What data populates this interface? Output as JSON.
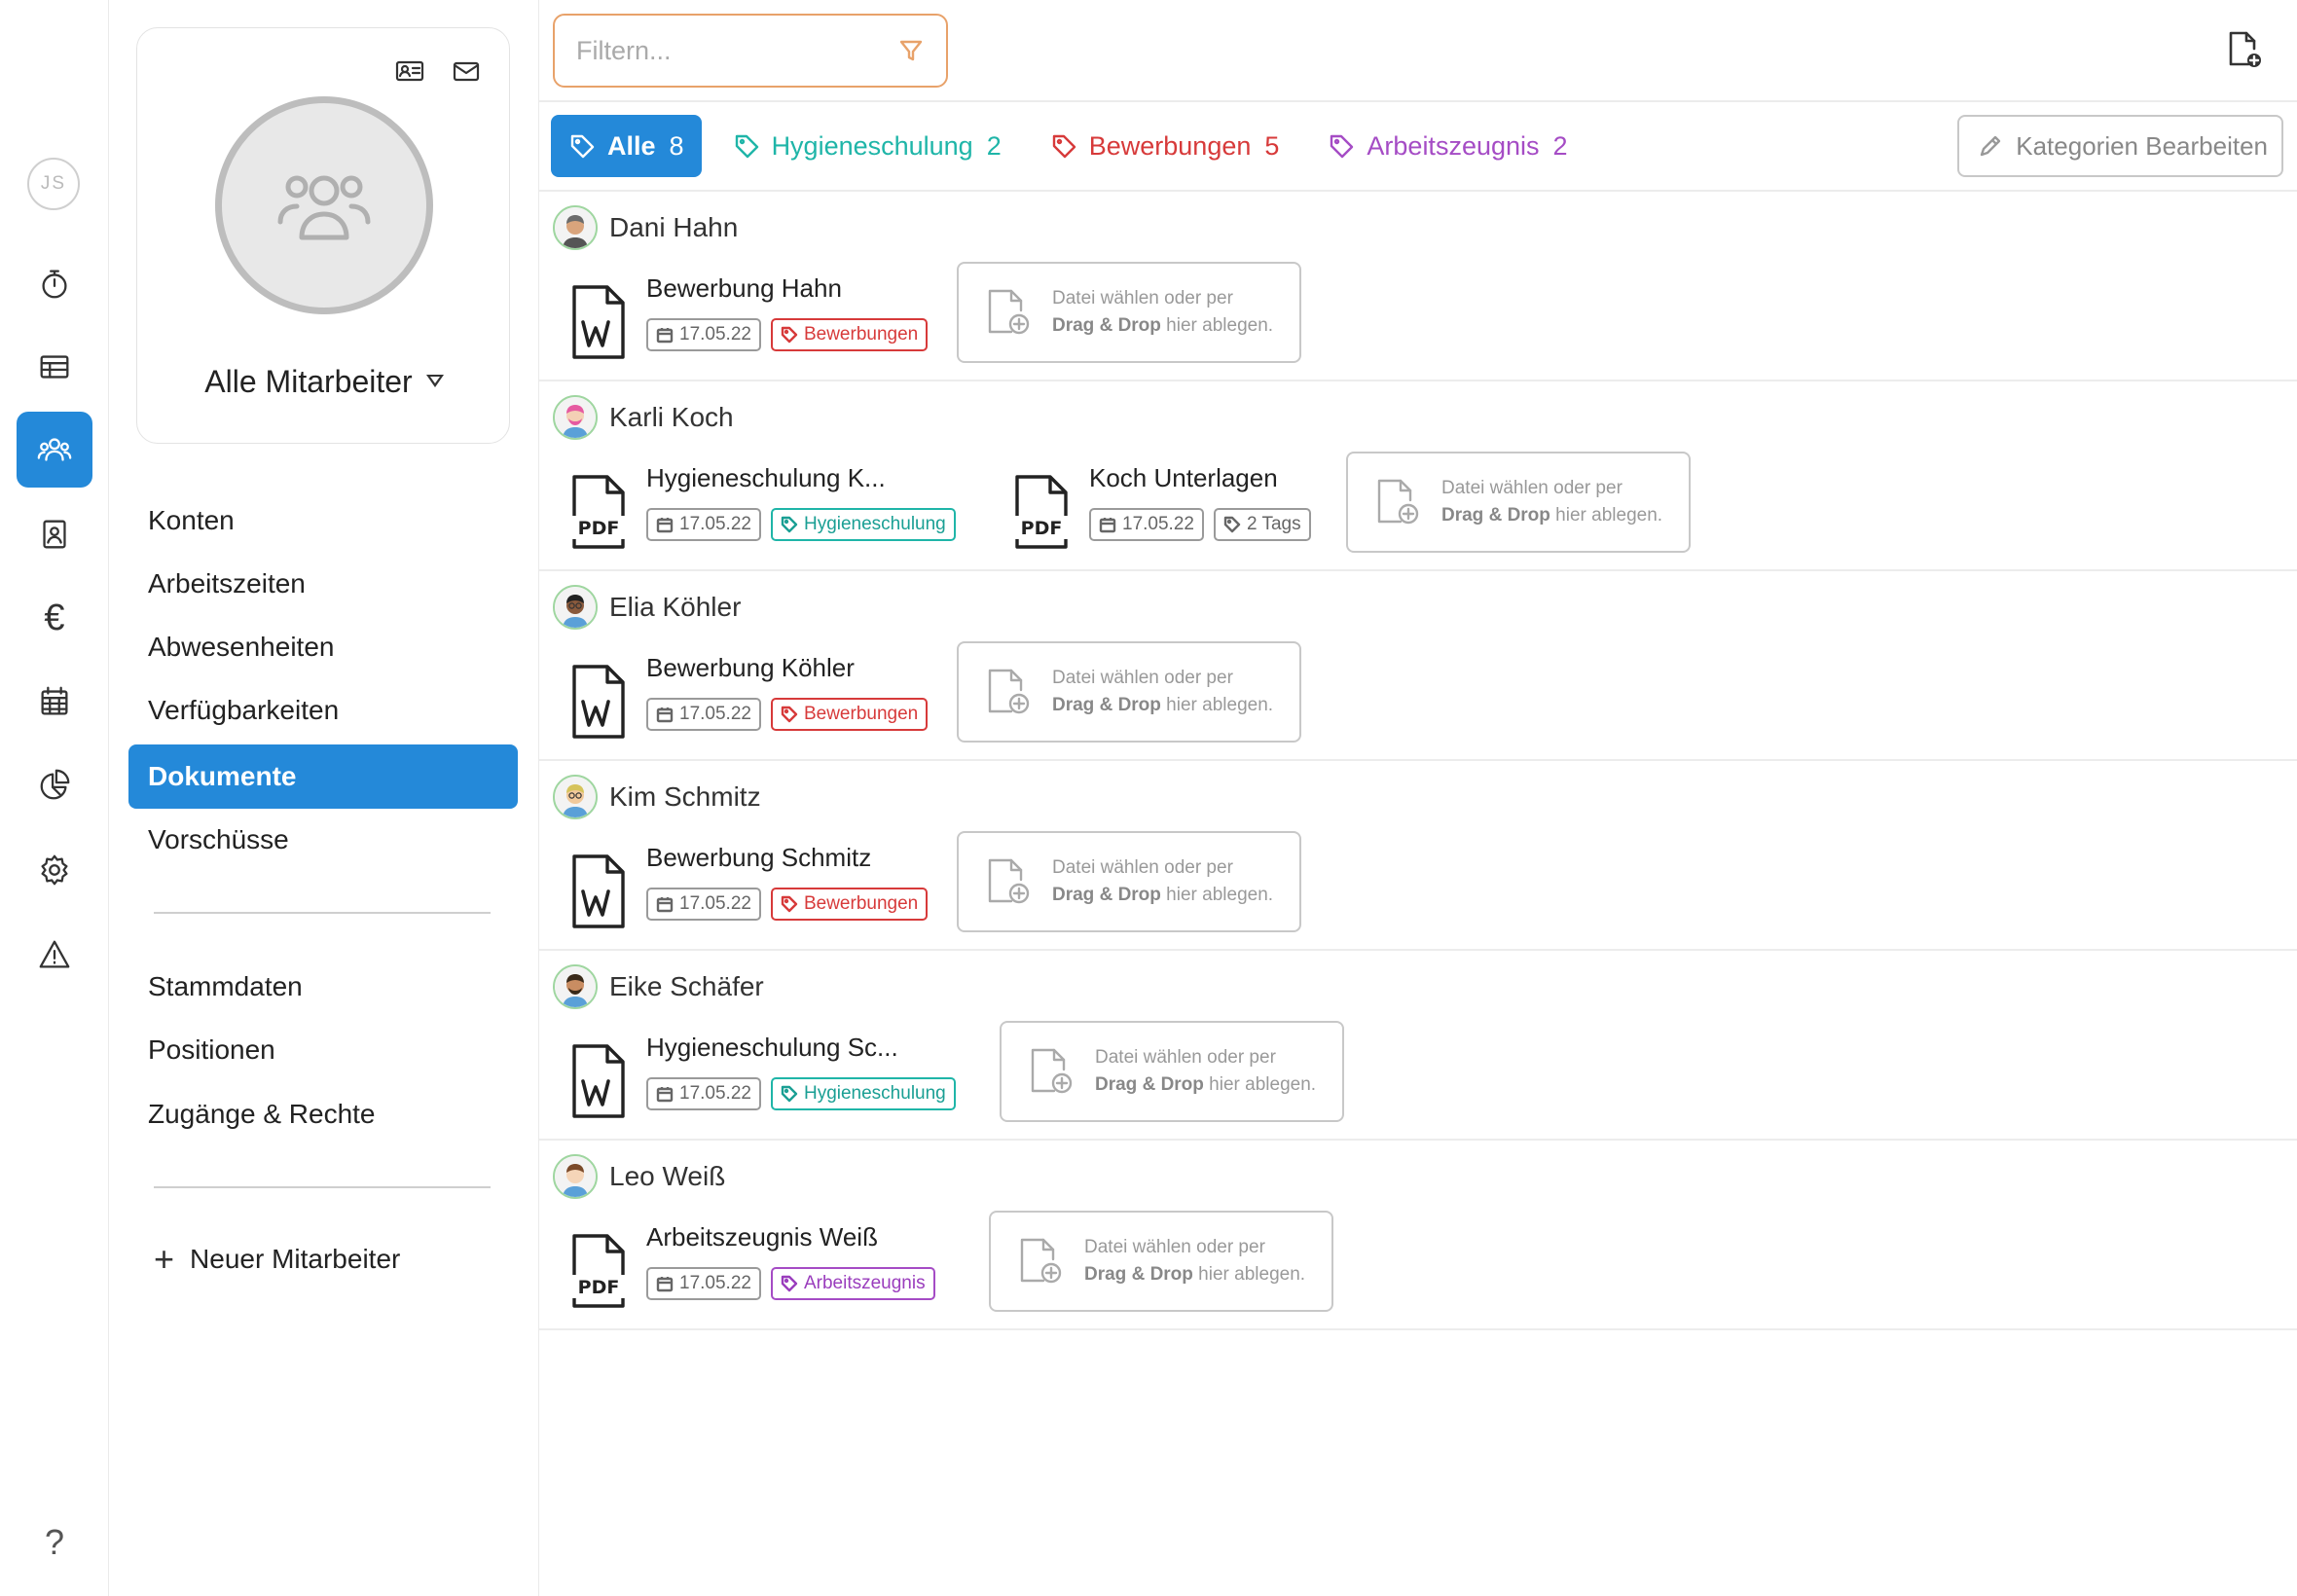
{
  "user_initials": "JS",
  "rail": [
    {
      "name": "timer-icon"
    },
    {
      "name": "table-icon"
    },
    {
      "name": "employees-icon",
      "active": true
    },
    {
      "name": "contact-card-icon"
    },
    {
      "name": "euro-icon",
      "glyph": "€"
    },
    {
      "name": "calendar-icon"
    },
    {
      "name": "pie-chart-icon"
    },
    {
      "name": "gear-icon"
    },
    {
      "name": "warning-icon"
    },
    {
      "name": "help-icon",
      "glyph": "?"
    }
  ],
  "profile": {
    "selector_label": "Alle Mitarbeiter"
  },
  "nav": {
    "items": [
      {
        "label": "Konten"
      },
      {
        "label": "Arbeitszeiten"
      },
      {
        "label": "Abwesenheiten"
      },
      {
        "label": "Verfügbarkeiten"
      },
      {
        "label": "Dokumente",
        "active": true
      },
      {
        "label": "Vorschüsse"
      }
    ],
    "items2": [
      {
        "label": "Stammdaten"
      },
      {
        "label": "Positionen"
      },
      {
        "label": "Zugänge & Rechte"
      }
    ],
    "new_employee": "Neuer Mitarbeiter",
    "new_employee_icon": "+"
  },
  "filter": {
    "placeholder": "Filtern..."
  },
  "tabs": [
    {
      "label": "Alle",
      "count": "8",
      "color": "#2489d9",
      "active": true
    },
    {
      "label": "Hygieneschulung",
      "count": "2",
      "color": "#1fb5a8"
    },
    {
      "label": "Bewerbungen",
      "count": "5",
      "color": "#d73a3a"
    },
    {
      "label": "Arbeitszeugnis",
      "count": "2",
      "color": "#a54cc5"
    }
  ],
  "edit_categories": "Kategorien Bearbeiten",
  "dropzone": {
    "line1": "Datei wählen oder per",
    "line2_bold": "Drag & Drop",
    "line2_rest": " hier ablegen."
  },
  "employees": [
    {
      "name": "Dani Hahn",
      "docs": [
        {
          "title": "Bewerbung Hahn",
          "type": "word",
          "date": "17.05.22",
          "tag": "Bewerbungen",
          "tag_color": "red"
        }
      ]
    },
    {
      "name": "Karli Koch",
      "docs": [
        {
          "title": "Hygieneschulung K...",
          "type": "pdf",
          "date": "17.05.22",
          "tag": "Hygieneschulung",
          "tag_color": "teal"
        },
        {
          "title": "Koch Unterlagen",
          "type": "pdf",
          "date": "17.05.22",
          "tag": "2 Tags",
          "tag_color": "gray"
        }
      ]
    },
    {
      "name": "Elia Köhler",
      "docs": [
        {
          "title": "Bewerbung Köhler",
          "type": "word",
          "date": "17.05.22",
          "tag": "Bewerbungen",
          "tag_color": "red"
        }
      ]
    },
    {
      "name": "Kim Schmitz",
      "docs": [
        {
          "title": "Bewerbung Schmitz",
          "type": "word",
          "date": "17.05.22",
          "tag": "Bewerbungen",
          "tag_color": "red"
        }
      ]
    },
    {
      "name": "Eike Schäfer",
      "docs": [
        {
          "title": "Hygieneschulung Sc...",
          "type": "word",
          "date": "17.05.22",
          "tag": "Hygieneschulung",
          "tag_color": "teal"
        }
      ]
    },
    {
      "name": "Leo Weiß",
      "docs": [
        {
          "title": "Arbeitszeugnis Weiß",
          "type": "pdf",
          "date": "17.05.22",
          "tag": "Arbeitszeugnis",
          "tag_color": "purple"
        }
      ]
    }
  ]
}
